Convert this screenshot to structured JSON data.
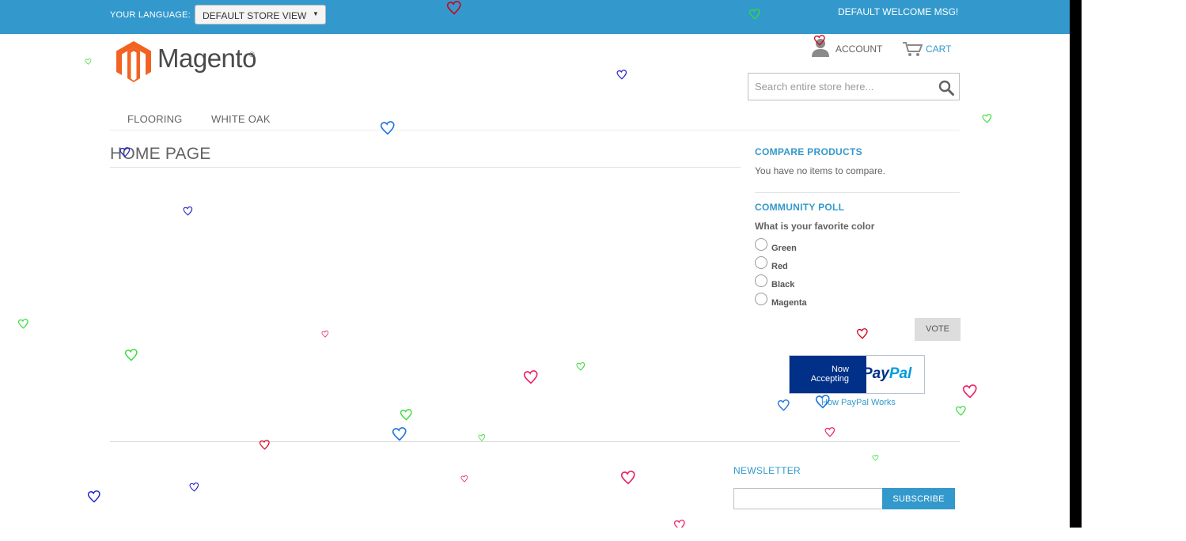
{
  "header": {
    "language_label": "YOUR LANGUAGE:",
    "store_view": "DEFAULT STORE VIEW",
    "welcome_msg": "DEFAULT WELCOME MSG!",
    "logo_text": "Magento",
    "logo_reg": "®",
    "account_label": "ACCOUNT",
    "cart_label": "CART",
    "search_placeholder": "Search entire store here..."
  },
  "nav": {
    "items": [
      {
        "label": "FLOORING"
      },
      {
        "label": "WHITE OAK"
      }
    ]
  },
  "main": {
    "page_title": "HOME PAGE"
  },
  "sidebar": {
    "compare": {
      "title": "COMPARE PRODUCTS",
      "empty_text": "You have no items to compare."
    },
    "poll": {
      "title": "COMMUNITY POLL",
      "question": "What is your favorite color",
      "options": [
        {
          "label": "Green"
        },
        {
          "label": "Red"
        },
        {
          "label": "Black"
        },
        {
          "label": "Magenta"
        }
      ],
      "vote_label": "VOTE"
    },
    "paypal": {
      "now_line1": "Now",
      "now_line2": "Accepting",
      "logo_part1": "Pay",
      "logo_part2": "Pal",
      "link_text": "How PayPal Works"
    }
  },
  "footer": {
    "newsletter_title": "NEWSLETTER",
    "subscribe_label": "SUBSCRIBE"
  },
  "colors": {
    "accent": "#3399cc",
    "logo_orange": "#f26322",
    "paypal_navy": "#003087"
  },
  "icons": {
    "logo": "magento-logo-icon",
    "account": "account-icon",
    "cart": "cart-icon",
    "search": "search-icon",
    "decor": "heart-icon"
  }
}
